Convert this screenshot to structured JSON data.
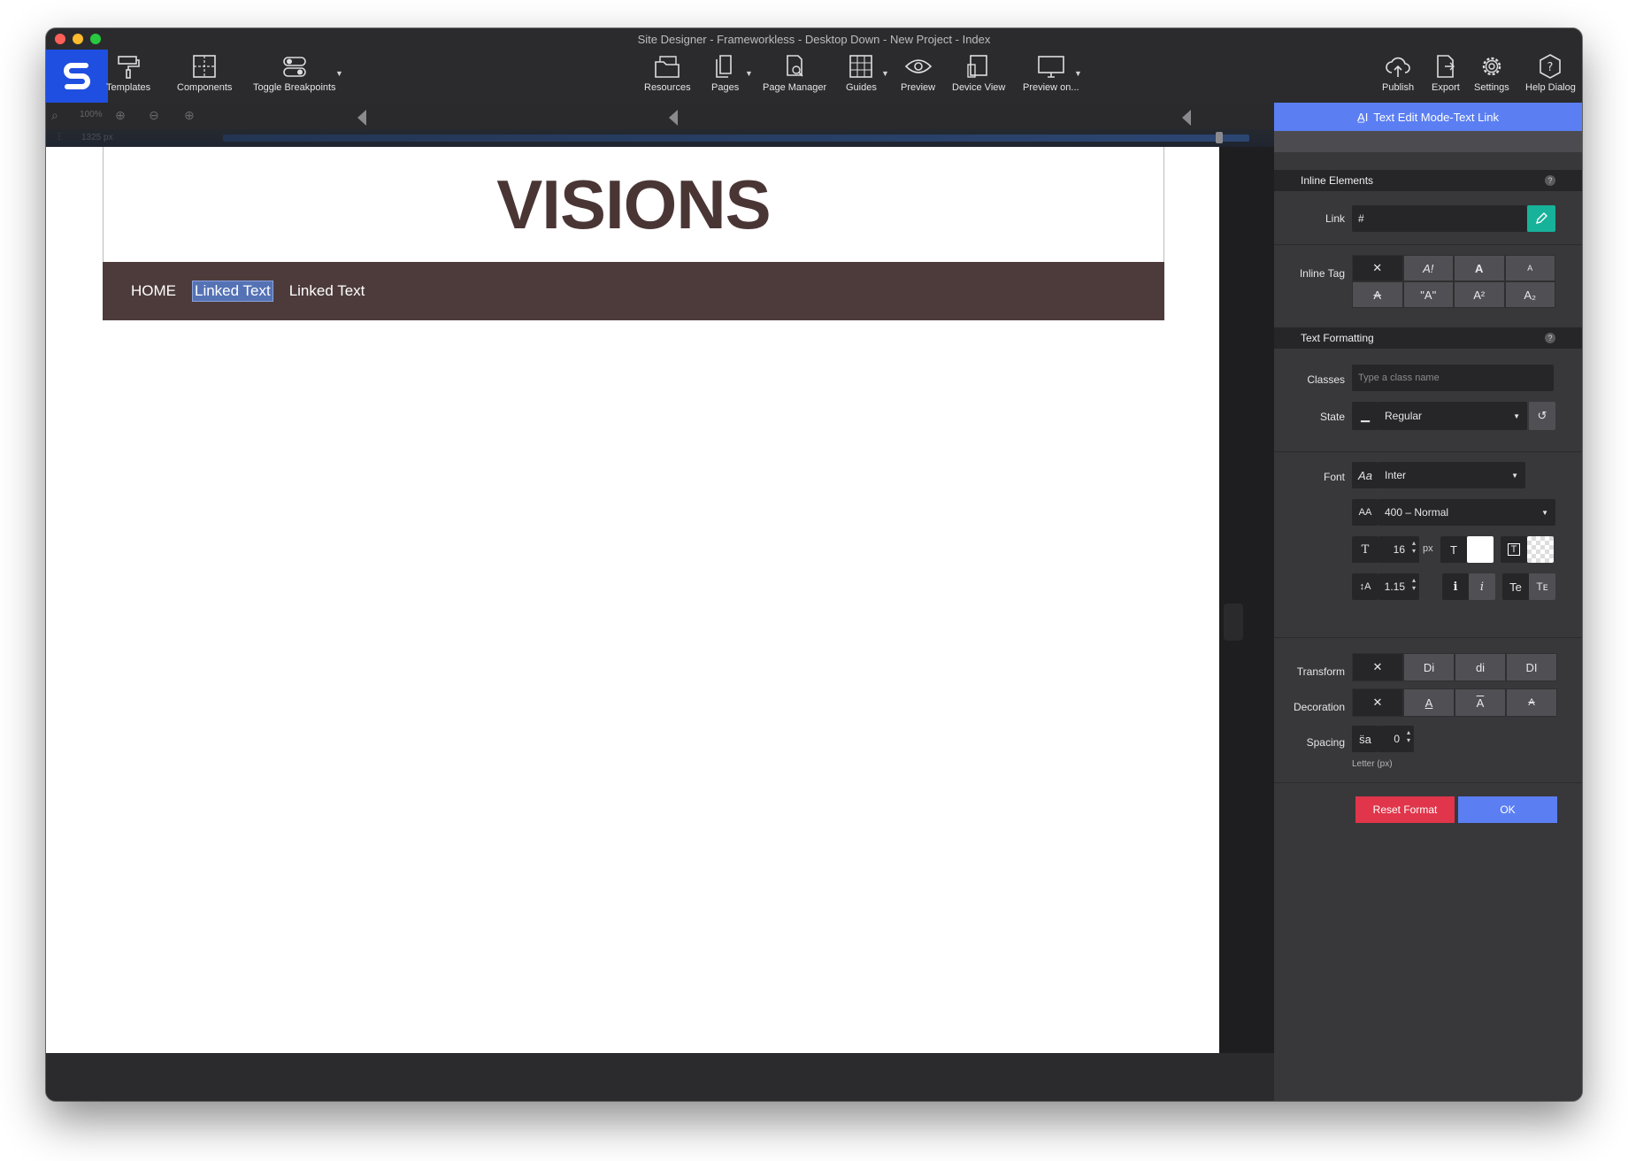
{
  "window": {
    "title": "Site Designer - Frameworkless - Desktop Down - New Project - Index"
  },
  "toolbar": {
    "left": [
      {
        "label": "Templates",
        "icon": "paint-roller-icon"
      },
      {
        "label": "Components",
        "icon": "components-icon"
      },
      {
        "label": "Toggle Breakpoints",
        "icon": "toggle-icon"
      }
    ],
    "center": [
      {
        "label": "Resources",
        "icon": "folder-icon"
      },
      {
        "label": "Pages",
        "icon": "pages-icon"
      },
      {
        "label": "Page Manager",
        "icon": "page-manager-icon"
      },
      {
        "label": "Guides",
        "icon": "guides-icon"
      },
      {
        "label": "Preview",
        "icon": "eye-icon"
      },
      {
        "label": "Device View",
        "icon": "device-icon"
      },
      {
        "label": "Preview on...",
        "icon": "monitor-icon"
      }
    ],
    "right": [
      {
        "label": "Publish",
        "icon": "cloud-upload-icon"
      },
      {
        "label": "Export",
        "icon": "export-icon"
      },
      {
        "label": "Settings",
        "icon": "gear-icon"
      },
      {
        "label": "Help Dialog",
        "icon": "help-icon"
      }
    ]
  },
  "zoombar": {
    "zoom": "100%",
    "width": "1325 px"
  },
  "site": {
    "title": "VISIONS",
    "nav": [
      "HOME",
      "Linked Text",
      "Linked Text"
    ]
  },
  "panel": {
    "header": "Text Edit Mode-Text Link",
    "inline_elements": {
      "title": "Inline Elements",
      "link_label": "Link",
      "link_value": "#",
      "inline_tag_label": "Inline Tag",
      "tags": [
        "✕",
        "A!",
        "A",
        "A",
        "A",
        "\"A\"",
        "A²",
        "A₂"
      ]
    },
    "text_formatting": {
      "title": "Text Formatting",
      "classes_label": "Classes",
      "classes_placeholder": "Type a class name",
      "state_label": "State",
      "state_value": "Regular",
      "font_label": "Font",
      "font_value": "Inter",
      "weight_value": "400 – Normal",
      "size_value": "16",
      "size_unit": "px",
      "line_height": "1.15",
      "styles": [
        "i",
        "i",
        "Te",
        "Tᴇ"
      ],
      "transform_label": "Transform",
      "transform_options": [
        "✕",
        "Di",
        "di",
        "DI"
      ],
      "decoration_label": "Decoration",
      "decoration_options": [
        "✕",
        "A",
        "A",
        "A"
      ],
      "spacing_label": "Spacing",
      "spacing_icon": "s̈a",
      "spacing_value": "0",
      "spacing_note": "Letter (px)"
    },
    "reset_label": "Reset Format",
    "ok_label": "OK"
  }
}
